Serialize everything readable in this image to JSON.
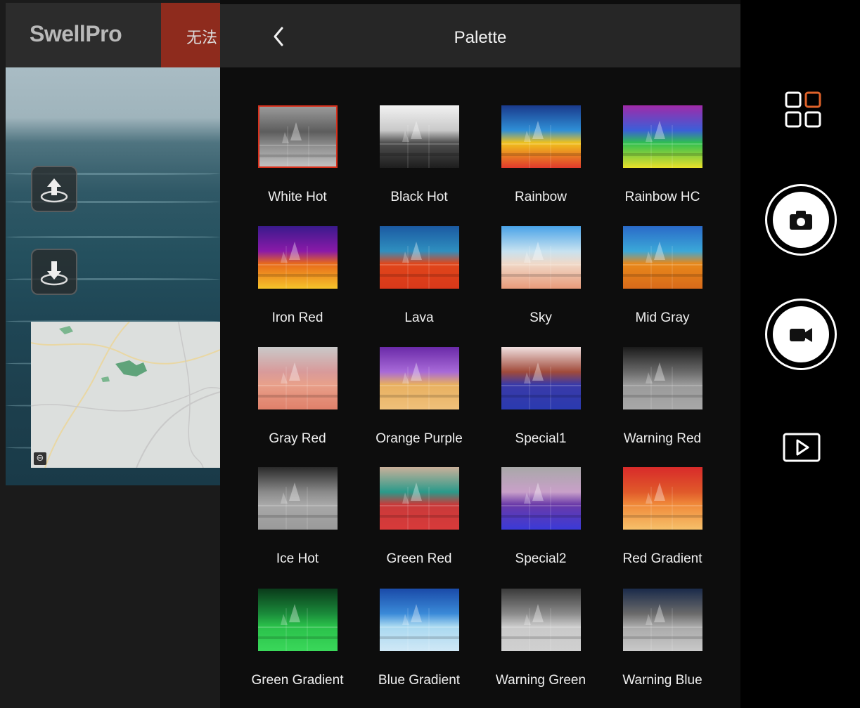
{
  "app": {
    "logo_text": "SwellPro",
    "status_text": "无法"
  },
  "palette": {
    "title": "Palette",
    "selected": "White Hot",
    "items": [
      {
        "label": "White Hot"
      },
      {
        "label": "Black Hot"
      },
      {
        "label": "Rainbow"
      },
      {
        "label": "Rainbow HC"
      },
      {
        "label": "Iron Red"
      },
      {
        "label": "Lava"
      },
      {
        "label": "Sky"
      },
      {
        "label": "Mid Gray"
      },
      {
        "label": "Gray Red"
      },
      {
        "label": "Orange Purple"
      },
      {
        "label": "Special1"
      },
      {
        "label": "Warning Red"
      },
      {
        "label": "Ice Hot"
      },
      {
        "label": "Green Red"
      },
      {
        "label": "Special2"
      },
      {
        "label": "Red Gradient"
      },
      {
        "label": "Green Gradient"
      },
      {
        "label": "Blue Gradient"
      },
      {
        "label": "Warning Green"
      },
      {
        "label": "Warning Blue"
      }
    ]
  },
  "colors": {
    "accent": "#d8311d",
    "grid_icon_accent": "#e0622a"
  },
  "icons": [
    "back-chevron-icon",
    "grid-icon",
    "camera-icon",
    "video-icon",
    "playback-icon",
    "upload-takeoff-icon",
    "landing-icon",
    "zoom-out-icon"
  ]
}
